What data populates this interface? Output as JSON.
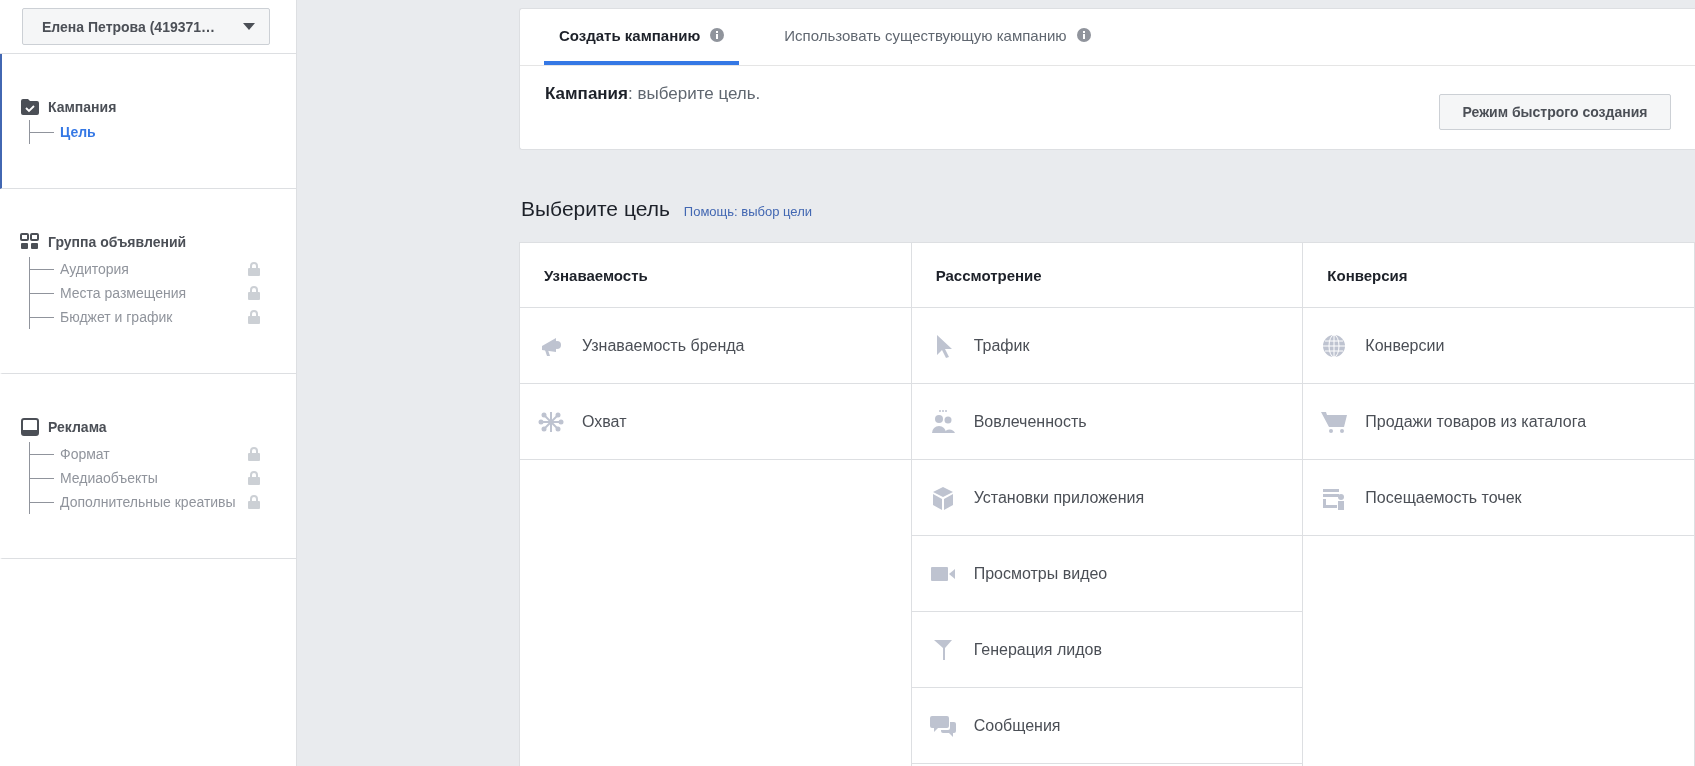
{
  "account_selector": {
    "value": "Елена Петрова (419371…"
  },
  "sidebar": {
    "sections": [
      {
        "title": "Кампания",
        "selected": true,
        "children": [
          {
            "label": "Цель",
            "selected": true,
            "locked": false
          }
        ]
      },
      {
        "title": "Группа объявлений",
        "selected": false,
        "children": [
          {
            "label": "Аудитория",
            "selected": false,
            "locked": true
          },
          {
            "label": "Места размещения",
            "selected": false,
            "locked": true
          },
          {
            "label": "Бюджет и график",
            "selected": false,
            "locked": true
          }
        ]
      },
      {
        "title": "Реклама",
        "selected": false,
        "children": [
          {
            "label": "Формат",
            "selected": false,
            "locked": true
          },
          {
            "label": "Медиаобъекты",
            "selected": false,
            "locked": true
          },
          {
            "label": "Дополнительные креативы",
            "selected": false,
            "locked": true
          }
        ]
      }
    ]
  },
  "tabs": [
    {
      "label": "Создать кампанию",
      "selected": true
    },
    {
      "label": "Использовать существующую кампанию",
      "selected": false
    }
  ],
  "campaign_status": "**Кампания**: выберите цель.",
  "quick_create_button": "Режим быстрого создания",
  "objective_heading": "Выберите цель",
  "help_link": "Помощь: выбор цели",
  "objective_columns": [
    {
      "title": "Узнаваемость",
      "items": [
        "Узнаваемость бренда",
        "Охват"
      ]
    },
    {
      "title": "Рассмотрение",
      "items": [
        "Трафик",
        "Вовлеченность",
        "Установки приложения",
        "Просмотры видео",
        "Генерация лидов",
        "Сообщения"
      ]
    },
    {
      "title": "Конверсия",
      "items": [
        "Конверсии",
        "Продажи товаров из каталога",
        "Посещаемость точек"
      ]
    }
  ]
}
